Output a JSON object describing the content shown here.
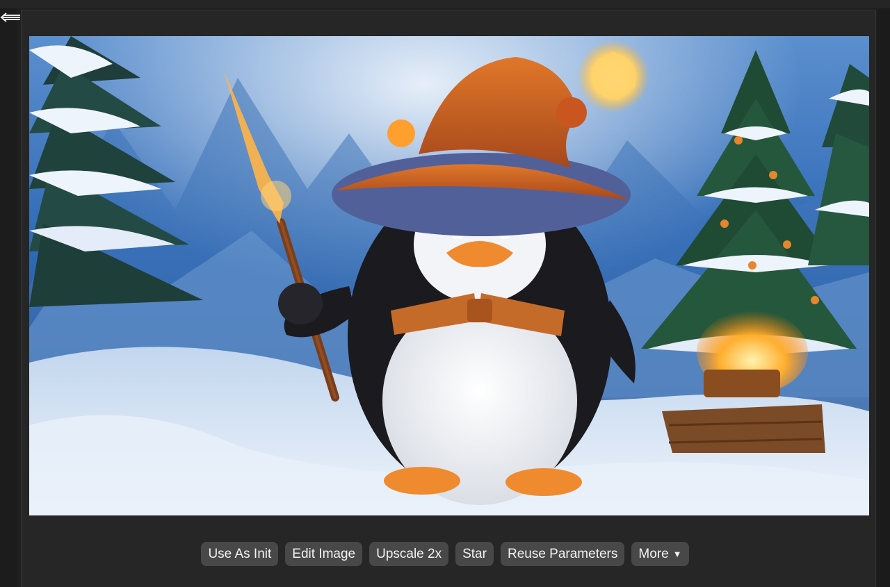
{
  "app": {
    "menu_icon": "back-arrow-menu-icon"
  },
  "image": {
    "subject": "penguin-wizard-snow-scene"
  },
  "toolbar": {
    "use_as_init": "Use As Init",
    "edit_image": "Edit Image",
    "upscale": "Upscale 2x",
    "star": "Star",
    "reuse_parameters": "Reuse Parameters",
    "more": "More",
    "more_icon": "caret-down-icon"
  },
  "colors": {
    "background": "#1f1f1f",
    "panel": "#262626",
    "button": "#484848",
    "button_text": "#f2f2f2"
  }
}
